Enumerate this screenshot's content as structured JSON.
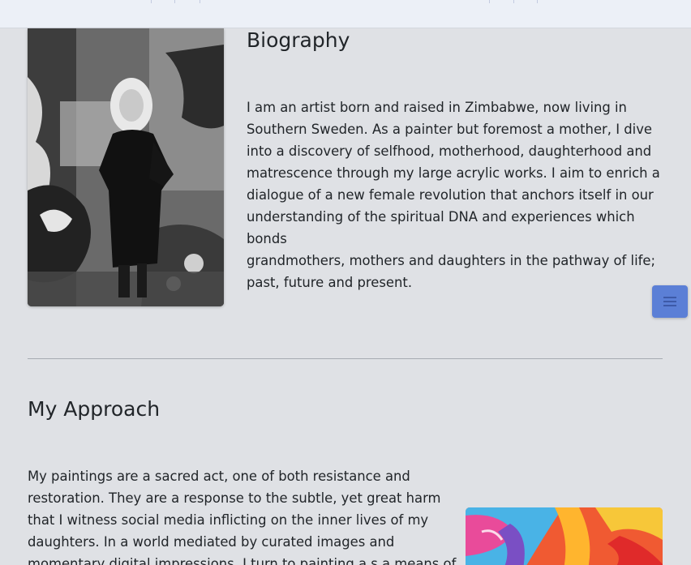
{
  "biography": {
    "title": "Biography",
    "lines": [
      "I am an artist born and raised in Zimbabwe, now living in",
      "Southern Sweden. As a painter but foremost a mother, I dive",
      "into a discovery of selfhood, motherhood, daughterhood and",
      "matrescence through my large acrylic works. I aim to enrich a",
      "dialogue of a new female revolution that anchors itself in our",
      "understanding of the spiritual DNA and experiences which",
      "bonds",
      "grandmothers, mothers and daughters in the pathway of life;",
      "past, future and present."
    ]
  },
  "approach": {
    "title": "My Approach",
    "lines": [
      "My paintings are a sacred act, one of both resistance and",
      "restoration. They are a response to the subtle, yet great harm",
      "that I witness social media inflicting on the inner lives of my",
      "daughters. In a world mediated by curated images and",
      "momentary digital impressions, I turn to painting a s a means of"
    ]
  },
  "menu_button": {
    "icon": "hamburger-menu-icon"
  },
  "colors": {
    "background": "#dfe1e5",
    "topbar": "#ecf0f7",
    "menu_button": "#5b7fd6",
    "text": "#212529"
  }
}
